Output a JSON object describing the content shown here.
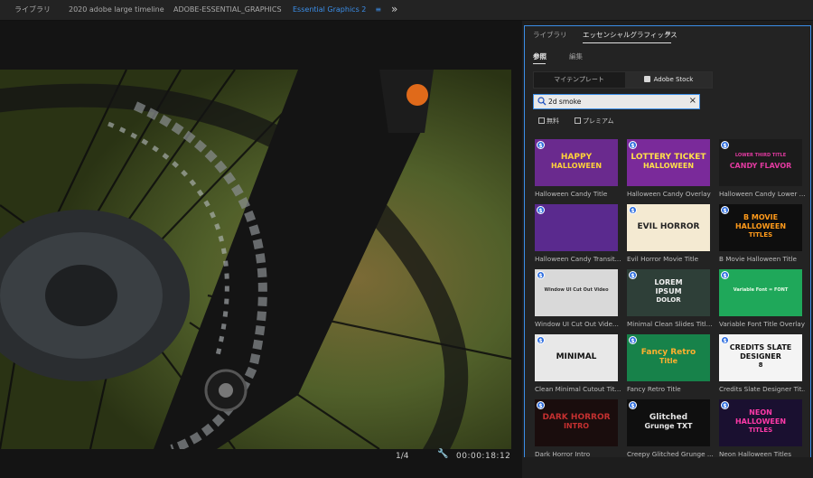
{
  "workspace_tabs": [
    {
      "label": "ライブラリ"
    },
    {
      "label": "2020 adobe large timeline"
    },
    {
      "label": "ADOBE-ESSENTIAL_GRAPHICS"
    },
    {
      "label": "Essential Graphics 2",
      "active": true
    }
  ],
  "workspace_menu_icon": "hamburger-menu-icon",
  "workspace_more_label": "»",
  "program_monitor": {
    "zoom": "1/4",
    "timecode": "00:00:18:12",
    "wrench_icon": "wrench-icon"
  },
  "panel": {
    "tabs": [
      "ライブラリ",
      "エッセンシャルグラフィックス"
    ],
    "menu_label": "≡",
    "subtabs": [
      "参照",
      "編集"
    ],
    "source_segment": {
      "my_templates": "マイテンプレート",
      "adobe_stock": "Adobe Stock",
      "selected": "Adobe Stock"
    },
    "search": {
      "value": "2d smoke",
      "search_icon": "search-icon",
      "clear_icon": "close-icon",
      "clear_label": "×"
    },
    "filters": [
      {
        "label": "無料",
        "checked": false
      },
      {
        "label": "プレミアム",
        "checked": false
      }
    ],
    "premium_badge": "$",
    "templates": [
      {
        "label": "Halloween Candy Title",
        "thumb_lines": [
          "HAPPY",
          "HALLOWEEN"
        ],
        "bg": "#6a2a8e",
        "fg": "#ffd23a"
      },
      {
        "label": "Halloween Candy Overlay",
        "thumb_lines": [
          "LOTTERY TICKET",
          "HALLOWEEN"
        ],
        "bg": "#7a2a9a",
        "fg": "#ffe04a"
      },
      {
        "label": "Halloween Candy Lower ...",
        "thumb_lines": [
          "LOWER THIRD TITLE",
          "CANDY FLAVOR"
        ],
        "bg": "#1b1b1b",
        "fg": "#e23aa0"
      },
      {
        "label": "Halloween Candy Transit...",
        "thumb_lines": [],
        "bg": "#5a2a8e",
        "fg": "#ffd23a"
      },
      {
        "label": "Evil Horror Movie Title",
        "thumb_lines": [
          "EVIL HORROR"
        ],
        "bg": "#f4ead2",
        "fg": "#222222"
      },
      {
        "label": "B Movie Halloween Title",
        "thumb_lines": [
          "B MOVIE",
          "HALLOWEEN",
          "TITLES"
        ],
        "bg": "#0e0e0e",
        "fg": "#ff9a1a"
      },
      {
        "label": "Window  UI Cut Out Vide...",
        "thumb_lines": [
          "Window UI Cut Out Video"
        ],
        "bg": "#d9d9d9",
        "fg": "#333333"
      },
      {
        "label": "Minimal Clean Slides Titl...",
        "thumb_lines": [
          "LOREM",
          "IPSUM",
          "DOLOR"
        ],
        "bg": "#2e3f38",
        "fg": "#f0f0f0"
      },
      {
        "label": "Variable Font Title Overlay",
        "thumb_lines": [
          "Variable Font = FONT"
        ],
        "bg": "#1fa85a",
        "fg": "#eafbe8"
      },
      {
        "label": "Clean Minimal Cutout Tit...",
        "thumb_lines": [
          "MINIMAL"
        ],
        "bg": "#e8e8e8",
        "fg": "#111111"
      },
      {
        "label": "Fancy Retro Title",
        "thumb_lines": [
          "Fancy Retro",
          "Title"
        ],
        "bg": "#17824a",
        "fg": "#ffb02e"
      },
      {
        "label": "Credits Slate Designer Tit...",
        "thumb_lines": [
          "CREDITS SLATE",
          "DESIGNER",
          "8"
        ],
        "bg": "#f4f4f4",
        "fg": "#111111"
      },
      {
        "label": "Dark Horror Intro",
        "thumb_lines": [
          "DARK HORROR",
          "INTRO"
        ],
        "bg": "#1a0d0d",
        "fg": "#c43030"
      },
      {
        "label": "Creepy Glitched Grunge ...",
        "thumb_lines": [
          "Glitched",
          "Grunge TXT"
        ],
        "bg": "#0f0f0f",
        "fg": "#e6e6e6"
      },
      {
        "label": "Neon Halloween Titles",
        "thumb_lines": [
          "NEON",
          "HALLOWEEN",
          "TITLES"
        ],
        "bg": "#1a1030",
        "fg": "#ff3aa8"
      }
    ]
  },
  "colors": {
    "accent": "#3b8ee8",
    "panel_bg": "#232323",
    "badge": "#2f6fe0"
  }
}
